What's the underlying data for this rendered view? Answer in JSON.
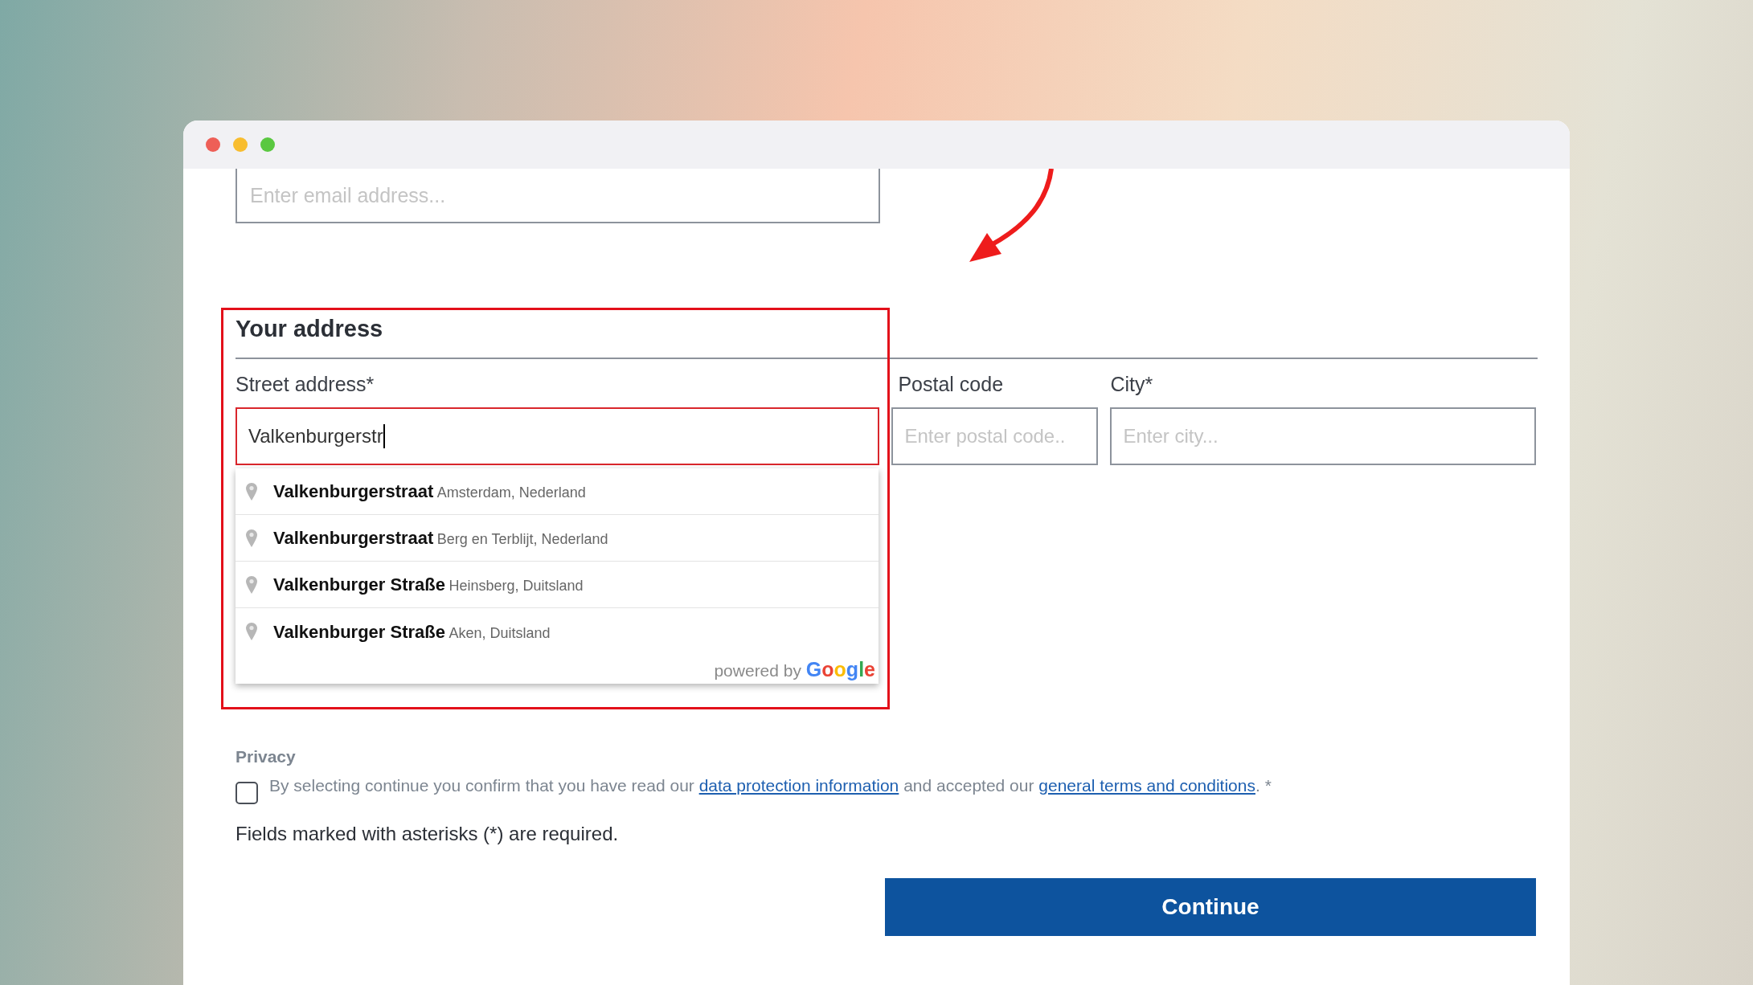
{
  "window": {
    "dots": [
      {
        "color": "#ee5f57"
      },
      {
        "color": "#f8bd2f"
      },
      {
        "color": "#5ac840"
      }
    ]
  },
  "email_field": {
    "placeholder": "Enter email address..."
  },
  "section": {
    "title": "Your address"
  },
  "fields": [
    {
      "label": "Street address*",
      "value": "Valkenburgerstr",
      "focused": true
    },
    {
      "label": "Postal code",
      "placeholder": "Enter postal code..",
      "focused": false
    },
    {
      "label": "City*",
      "placeholder": "Enter city...",
      "focused": false
    }
  ],
  "suggestions": [
    {
      "main": "Valkenburgerstraat",
      "secondary": "Amsterdam, Nederland"
    },
    {
      "main": "Valkenburgerstraat",
      "secondary": "Berg en Terblijt, Nederland"
    },
    {
      "main": "Valkenburger Straße",
      "secondary": "Heinsberg, Duitsland"
    },
    {
      "main": "Valkenburger Straße",
      "secondary": "Aken, Duitsland"
    }
  ],
  "attribution": {
    "prefix": "powered by",
    "brand": "Google"
  },
  "privacy": {
    "heading": "Privacy",
    "checked": false,
    "text_before": "By selecting continue you confirm that you have read our",
    "link_1": "data protection information",
    "text_middle": "and accepted our",
    "link_2": "general terms and conditions",
    "text_after": ". *"
  },
  "required_note": "Fields marked with asterisks (*) are required.",
  "continue_button": "Continue"
}
